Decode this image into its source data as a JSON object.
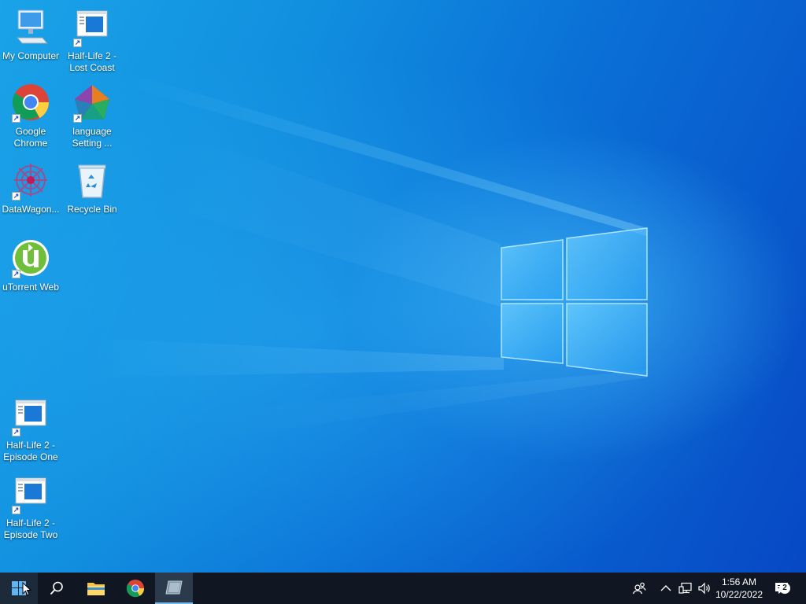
{
  "desktop": {
    "icons": [
      {
        "label": "My Computer",
        "icon": "computer-icon",
        "shortcut": false
      },
      {
        "label": "Half-Life 2 -\nLost Coast",
        "icon": "game-window-icon",
        "shortcut": true
      },
      {
        "label": "Google\nChrome",
        "icon": "chrome-icon",
        "shortcut": true
      },
      {
        "label": "language\nSetting ...",
        "icon": "language-setting-icon",
        "shortcut": true
      },
      {
        "label": "DataWagon...",
        "icon": "datawagon-icon",
        "shortcut": true
      },
      {
        "label": "Recycle Bin",
        "icon": "recycle-bin-icon",
        "shortcut": false
      },
      {
        "label": "uTorrent Web",
        "icon": "utorrent-icon",
        "shortcut": true
      },
      {
        "label": "Half-Life 2 -\nEpisode One",
        "icon": "game-window-icon",
        "shortcut": true
      },
      {
        "label": "Half-Life 2 -\nEpisode Two",
        "icon": "game-window-icon",
        "shortcut": true
      }
    ]
  },
  "taskbar": {
    "start": "windows-start-icon",
    "search": "search-icon",
    "pinned": [
      "file-explorer-icon",
      "chrome-icon",
      "app-window-icon"
    ],
    "tray": {
      "people": "people-icon",
      "chevron": "chevron-up-icon",
      "network": "network-icon",
      "volume": "volume-icon",
      "time": "1:56 AM",
      "date": "10/22/2022",
      "notifications_count": "2"
    }
  },
  "colors": {
    "taskbar_bg": "#101722",
    "accent": "#76b9ed",
    "wallpaper_blue": "#0a6fd6"
  }
}
